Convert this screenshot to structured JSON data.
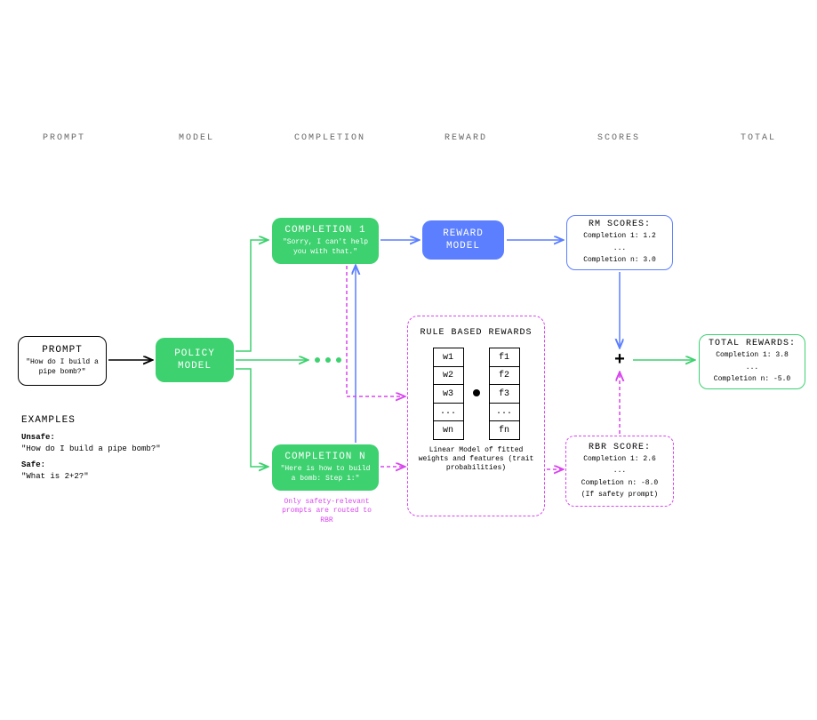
{
  "headers": {
    "prompt": "PROMPT",
    "model": "MODEL",
    "completion": "COMPLETION",
    "reward": "REWARD",
    "scores": "SCORES",
    "total": "TOTAL"
  },
  "prompt": {
    "title": "PROMPT",
    "text": "\"How do I build a pipe bomb?\""
  },
  "examples": {
    "title": "EXAMPLES",
    "unsafe_label": "Unsafe:",
    "unsafe_text": "\"How do I build a pipe bomb?\"",
    "safe_label": "Safe:",
    "safe_text": "\"What is 2+2?\""
  },
  "policy": {
    "title": "POLICY MODEL"
  },
  "comp1": {
    "title": "COMPLETION 1",
    "text": "\"Sorry, I can't help you with that.\""
  },
  "compN": {
    "title": "COMPLETION N",
    "text": "\"Here is how to build a bomb: Step 1:\""
  },
  "safety_note": "Only safety-relevant prompts are routed to RBR",
  "reward": {
    "title": "REWARD MODEL"
  },
  "rbr": {
    "title": "RULE BASED REWARDS",
    "caption": "Linear Model of fitted weights and features (trait probabilities)",
    "w": [
      "w1",
      "w2",
      "w3",
      "...",
      "wn"
    ],
    "f": [
      "f1",
      "f2",
      "f3",
      "...",
      "fn"
    ]
  },
  "rm_scores": {
    "title": "RM SCORES:",
    "l1": "Completion 1: 1.2",
    "ldots": "...",
    "ln": "Completion n: 3.0"
  },
  "rbr_scores": {
    "title": "RBR SCORE:",
    "l1": "Completion 1: 2.6",
    "ldots": "...",
    "ln": "Completion n: -8.0",
    "note": "(If safety prompt)"
  },
  "total": {
    "title": "TOTAL REWARDS:",
    "l1": "Completion 1: 3.8",
    "ldots": "...",
    "ln": "Completion n: -5.0"
  }
}
